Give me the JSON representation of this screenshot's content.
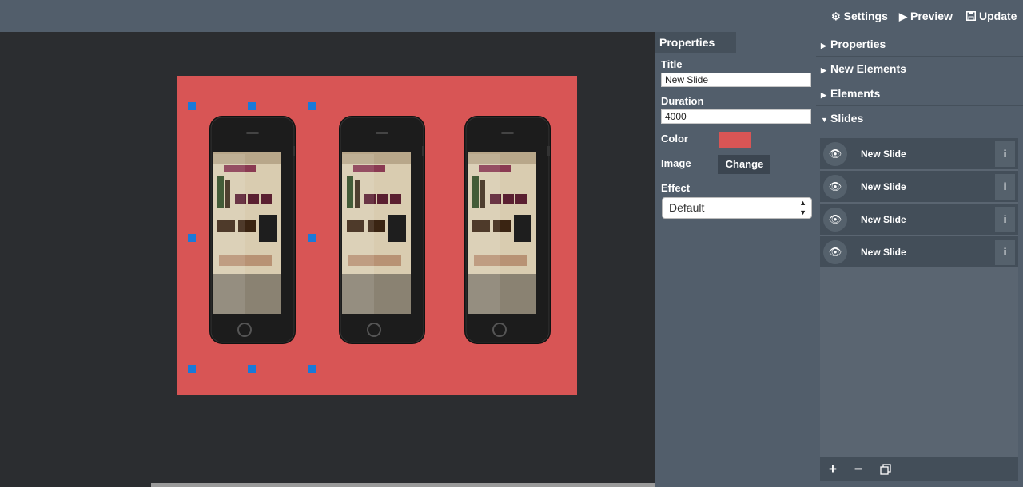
{
  "toolbar": {
    "settings_label": "Settings",
    "preview_label": "Preview",
    "update_label": "Update",
    "settings_icon": "gear-icon",
    "preview_icon": "play-icon",
    "update_icon": "save-icon"
  },
  "canvas": {
    "slide_background": "#d85555",
    "handle_color": "#1b79d8",
    "phone_count": 3
  },
  "properties": {
    "tab_label": "Properties",
    "title_label": "Title",
    "title_value": "New Slide",
    "duration_label": "Duration",
    "duration_value": "4000",
    "color_label": "Color",
    "color_value": "#d85555",
    "image_label": "Image",
    "change_label": "Change",
    "effect_label": "Effect",
    "effect_value": "Default"
  },
  "sidebar": {
    "sections": [
      {
        "label": "Properties",
        "expanded": false
      },
      {
        "label": "New Elements",
        "expanded": false
      },
      {
        "label": "Elements",
        "expanded": false
      },
      {
        "label": "Slides",
        "expanded": true
      }
    ],
    "slides": [
      {
        "name": "New Slide"
      },
      {
        "name": "New Slide"
      },
      {
        "name": "New Slide"
      },
      {
        "name": "New Slide"
      }
    ],
    "footer_buttons": [
      "add-icon",
      "remove-icon",
      "duplicate-icon"
    ]
  }
}
